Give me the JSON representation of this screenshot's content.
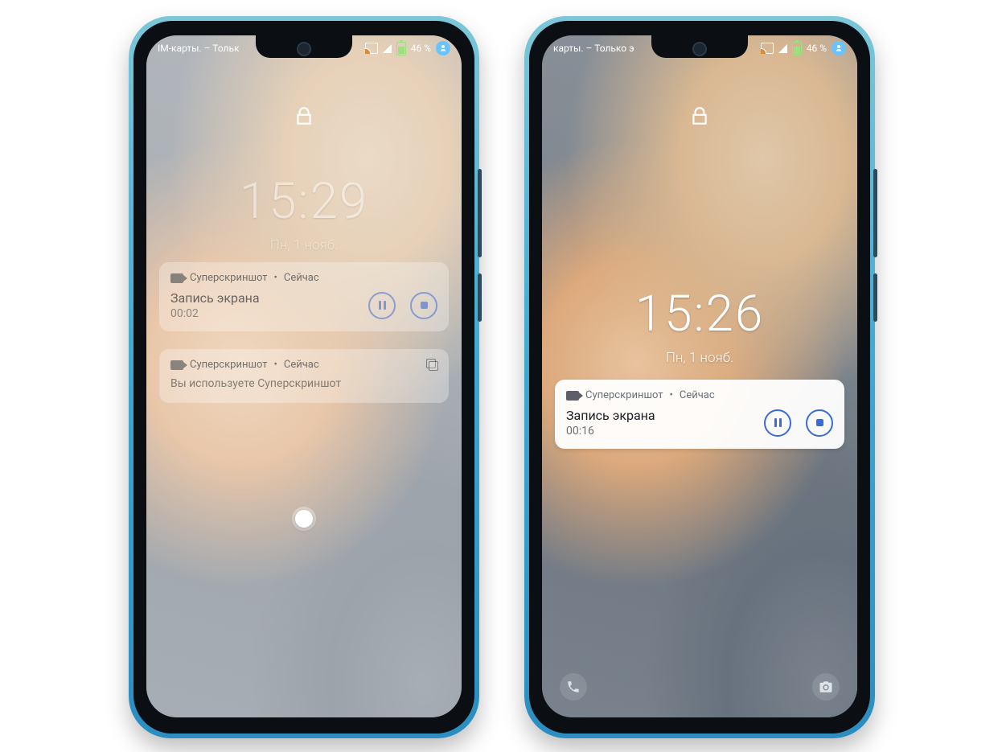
{
  "left": {
    "status": {
      "left_text": "IM-карты. – Тольк",
      "battery_pct": "46 %"
    },
    "clock": {
      "time": "15:29",
      "date": "Пн, 1 нояб."
    },
    "notif1": {
      "app": "Суперскриншот",
      "when": "Сейчас",
      "sep": " • ",
      "title": "Запись экрана",
      "timer": "00:02"
    },
    "notif2": {
      "app": "Суперскриншот",
      "when": "Сейчас",
      "sep": " • ",
      "line": "Вы используете Суперскриншот"
    }
  },
  "right": {
    "status": {
      "left_text": "карты. – Только э",
      "battery_pct": "46 %"
    },
    "clock": {
      "time": "15:26",
      "date": "Пн, 1 нояб."
    },
    "notif": {
      "app": "Суперскриншот",
      "when": "Сейчас",
      "sep": " • ",
      "title": "Запись экрана",
      "timer": "00:16"
    }
  }
}
